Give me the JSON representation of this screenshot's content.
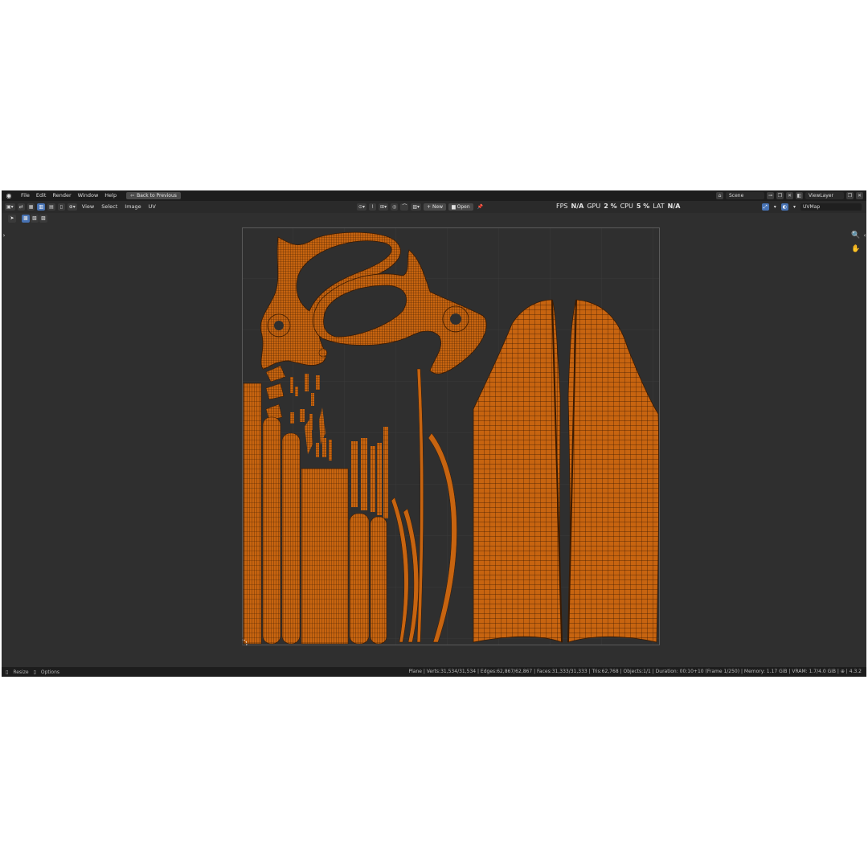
{
  "menubar": {
    "items": [
      "File",
      "Edit",
      "Render",
      "Window",
      "Help"
    ],
    "back_button": "Back to Previous",
    "scene": "Scene",
    "view_layer": "ViewLayer"
  },
  "header": {
    "menus": [
      "View",
      "Select",
      "Image",
      "UV"
    ],
    "new_label": "New",
    "open_label": "Open",
    "uvmap": "UVMap"
  },
  "stats": {
    "fps_label": "FPS",
    "fps_value": "N/A",
    "gpu_label": "GPU",
    "gpu_value": "2 %",
    "cpu_label": "CPU",
    "cpu_value": "5 %",
    "lat_label": "LAT",
    "lat_value": "N/A"
  },
  "statusbar": {
    "resize": "Resize",
    "options": "Options",
    "info": "Plane | Verts:31,534/31,534 | Edges:62,867/62,867 | Faces:31,333/31,333 | Tris:62,768 | Objects:1/1 | Duration: 00:10+10 (Frame 1/250) | Memory: 1.17 GiB | VRAM: 1.7/4.0 GiB | ⊕ | 4.3.2"
  },
  "colors": {
    "uv_island": "#c76410",
    "uv_wire": "#3a1a02",
    "background": "#2f2f2f"
  },
  "icons": [
    "blender-logo-icon",
    "zoom-icon",
    "hand-icon",
    "cursor-icon"
  ]
}
